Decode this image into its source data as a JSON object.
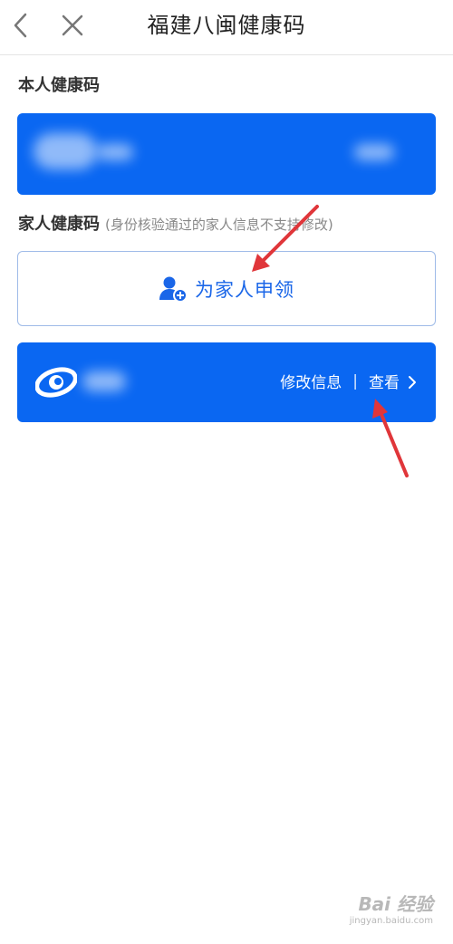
{
  "header": {
    "title": "福建八闽健康码",
    "back_icon": "chevron-left-icon",
    "close_icon": "close-icon"
  },
  "self_section": {
    "label": "本人健康码"
  },
  "family_section": {
    "label": "家人健康码",
    "note": "(身份核验通过的家人信息不支持修改)"
  },
  "apply_button": {
    "label": "为家人申领",
    "icon": "add-user-icon"
  },
  "family_card": {
    "edit_label": "修改信息",
    "separator": "|",
    "view_label": "查看",
    "chevron_icon": "chevron-right-icon",
    "logo_icon": "eye-logo-icon"
  },
  "colors": {
    "primary": "#0a67f2",
    "link": "#1a66e8",
    "annotation_arrow": "#e0363a"
  },
  "watermark": {
    "main": "Bai 经验",
    "sub": "jingyan.baidu.com"
  }
}
